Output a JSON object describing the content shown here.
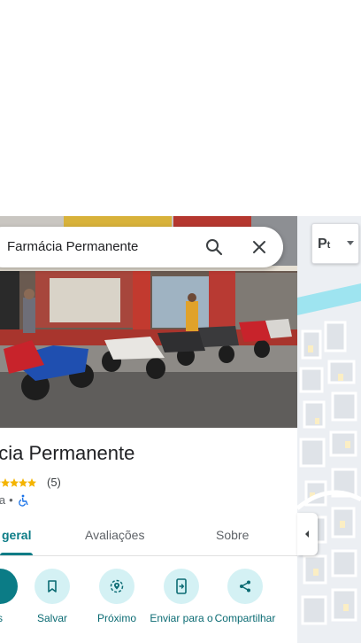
{
  "search": {
    "query": "Farmácia Permanente"
  },
  "place": {
    "name": "ácia Permanente",
    "rating_count": "(5)",
    "category": "ia"
  },
  "tabs": [
    {
      "label": "geral"
    },
    {
      "label": "Avaliações"
    },
    {
      "label": "Sobre"
    }
  ],
  "actions": [
    {
      "label": "s"
    },
    {
      "label": "Salvar"
    },
    {
      "label": "Próximo"
    },
    {
      "label": "Enviar para o"
    },
    {
      "label": "Compartilhar"
    }
  ],
  "map": {
    "layer_label": "P",
    "layer_sub": "t"
  },
  "icons": [
    "search-icon",
    "close-icon",
    "star-icon",
    "wheelchair-icon",
    "bookmark-icon",
    "nearby-icon",
    "send-to-phone-icon",
    "share-icon",
    "chevron-left-icon",
    "dropdown-arrow-icon"
  ],
  "colors": {
    "accent": "#0b7c86",
    "action_bg": "#d4f1f4",
    "star": "#f4b400"
  }
}
